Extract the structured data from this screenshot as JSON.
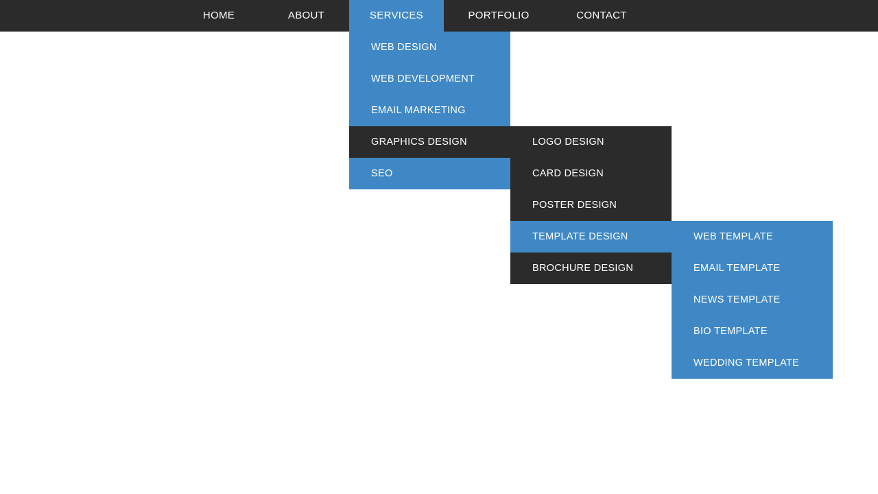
{
  "colors": {
    "dark": "#2b2b2b",
    "accent": "#3f88c5"
  },
  "nav": {
    "items": [
      {
        "label": "HOME"
      },
      {
        "label": "ABOUT"
      },
      {
        "label": "SERVICES"
      },
      {
        "label": "PORTFOLIO"
      },
      {
        "label": "CONTACT"
      }
    ],
    "active_index": 2
  },
  "services_submenu": [
    {
      "label": "WEB DESIGN"
    },
    {
      "label": "WEB DEVELOPMENT"
    },
    {
      "label": "EMAIL MARKETING"
    },
    {
      "label": "GRAPHICS DESIGN"
    },
    {
      "label": "SEO"
    }
  ],
  "graphics_submenu": [
    {
      "label": "LOGO DESIGN"
    },
    {
      "label": "CARD DESIGN"
    },
    {
      "label": "POSTER DESIGN"
    },
    {
      "label": "TEMPLATE DESIGN"
    },
    {
      "label": "BROCHURE DESIGN"
    }
  ],
  "template_submenu": [
    {
      "label": "WEB TEMPLATE"
    },
    {
      "label": "EMAIL TEMPLATE"
    },
    {
      "label": "NEWS TEMPLATE"
    },
    {
      "label": "BIO TEMPLATE"
    },
    {
      "label": "WEDDING TEMPLATE"
    }
  ]
}
